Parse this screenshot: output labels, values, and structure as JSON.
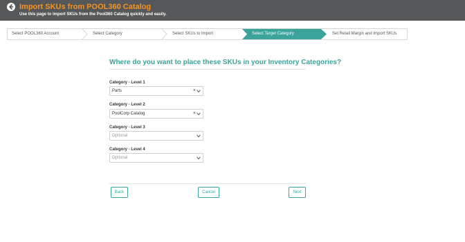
{
  "header": {
    "title": "Import SKUs from POOL360 Catalog",
    "subtitle": "Use this page to import SKUs from the Pool360 Catalog quickly and easily.",
    "back_icon": "back-arrow-circle-icon",
    "bg_color": "#555759",
    "title_color": "#f7931e"
  },
  "steps": [
    {
      "label": "Select POOL360 Account",
      "active": false
    },
    {
      "label": "Select Category",
      "active": false
    },
    {
      "label": "Select SKUs to Import",
      "active": false
    },
    {
      "label": "Select Target Category",
      "active": true
    },
    {
      "label": "Set Retail Margin and Import SKUs",
      "active": false
    }
  ],
  "accent_color": "#3aa39a",
  "question": "Where do you want to place these SKUs in your Inventory Categories?",
  "fields": [
    {
      "label": "Category - Level 1",
      "value": "Parts",
      "placeholder": "",
      "clearable": true
    },
    {
      "label": "Category - Level 2",
      "value": "PoolCorp Catalog",
      "placeholder": "",
      "clearable": true
    },
    {
      "label": "Category - Level 3",
      "value": "",
      "placeholder": "Optional",
      "clearable": false
    },
    {
      "label": "Category - Level 4",
      "value": "",
      "placeholder": "Optional",
      "clearable": false
    }
  ],
  "buttons": {
    "back": "Back",
    "cancel": "Cancel",
    "next": "Next"
  }
}
